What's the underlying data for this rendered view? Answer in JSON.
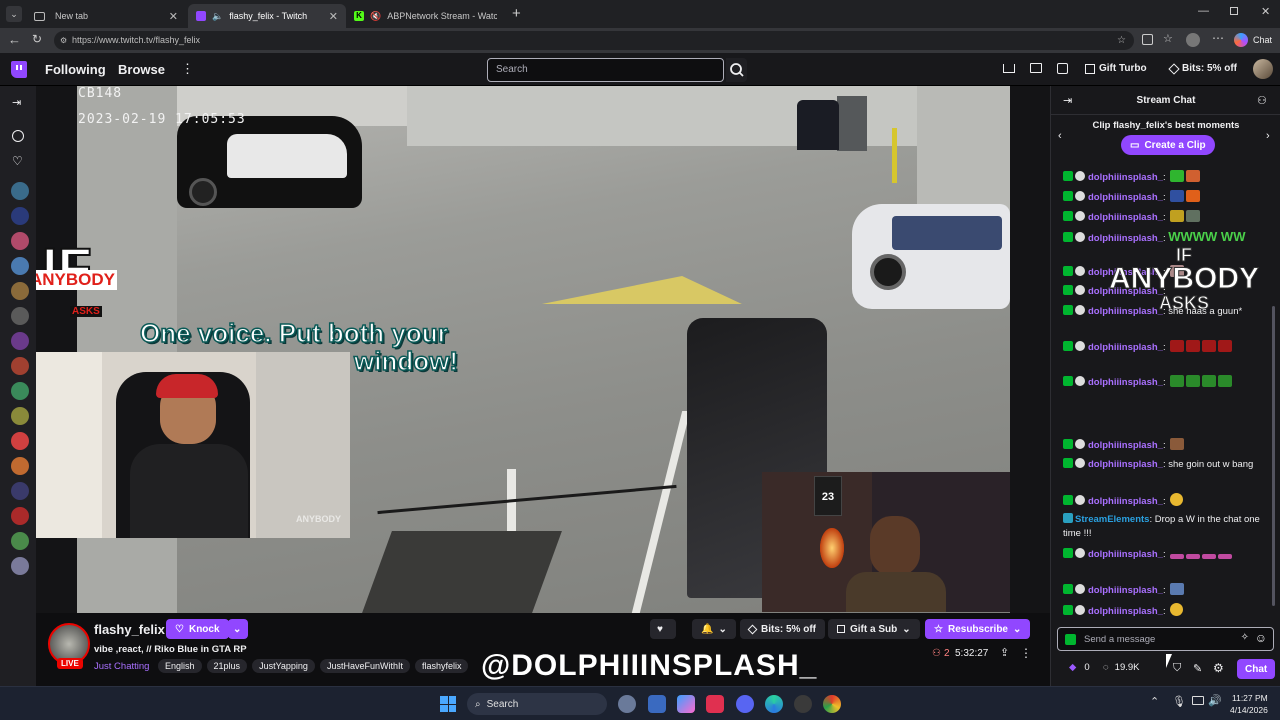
{
  "browser": {
    "tabs": [
      {
        "label": "New tab",
        "active": false
      },
      {
        "label": "flashy_felix - Twitch",
        "active": true
      },
      {
        "label": "ABPNetwork Stream - Watch",
        "active": false
      }
    ],
    "url": "https://www.twitch.tv/flashy_felix",
    "chat_label": "Chat"
  },
  "nav": {
    "following": "Following",
    "browse": "Browse",
    "search_placeholder": "Search",
    "gift_turbo": "Gift Turbo",
    "bits": "Bits: 5% off"
  },
  "video": {
    "cam_id": "CB148",
    "timestamp": "2023-02-19 17:05:53",
    "caption_line1": "One voice. Put both your",
    "caption_line2": "window!",
    "logo_top": "IF",
    "logo_mid": "ANYBODY",
    "logo_bot": "ASKS",
    "jersey": "23"
  },
  "stream": {
    "channel": "flashy_felix",
    "knock": "Knock",
    "title": "vibe ,react, // Riko Blue in GTA RP",
    "live": "LIVE",
    "category": "Just Chatting",
    "tags": [
      "English",
      "21plus",
      "JustYapping",
      "JustHaveFunWithIt",
      "flashyfelix"
    ],
    "bits": "Bits: 5% off",
    "gift_sub": "Gift a Sub",
    "resubscribe": "Resubscribe",
    "viewers": "2",
    "uptime": "5:32:27",
    "watermark": "@DOLPHIIINSPLASH_"
  },
  "chat": {
    "title": "Stream Chat",
    "clip_prompt": "Clip flashy_felix's best moments",
    "create_clip": "Create a Clip",
    "messages": [
      {
        "user": "dolphiiinsplash_",
        "text": ""
      },
      {
        "user": "dolphiiinsplash_",
        "text": ""
      },
      {
        "user": "dolphiiinsplash_",
        "text": ""
      },
      {
        "user": "dolphiiinsplash_",
        "text": "WWWW WW"
      },
      {
        "user": "dolphiiinsplash_",
        "text": ""
      },
      {
        "user": "dolphiiinsplash_",
        "text": ""
      },
      {
        "user": "dolphiiinsplash_",
        "text": "she haas a guun*"
      },
      {
        "user": "dolphiiinsplash_",
        "text": ""
      },
      {
        "user": "dolphiiinsplash_",
        "text": ""
      },
      {
        "user": "dolphiiinsplash_",
        "text": ""
      },
      {
        "user": "dolphiiinsplash_",
        "text": "she goin out w bang"
      },
      {
        "user": "dolphiiinsplash_",
        "text": ""
      },
      {
        "user": "StreamElements",
        "text": "Drop a W in the chat one time !!!"
      },
      {
        "user": "dolphiiinsplash_",
        "text": ""
      },
      {
        "user": "dolphiiinsplash_",
        "text": ""
      },
      {
        "user": "dolphiiinsplash_",
        "text": ""
      }
    ],
    "chat_overlay_if": "IF",
    "chat_overlay_anybody": "ANYBODY",
    "chat_overlay_asks": "ASKS",
    "input_placeholder": "Send a message",
    "points": "0",
    "channel_points": "19.9K",
    "chat_button": "Chat"
  },
  "taskbar": {
    "search": "Search",
    "time": "11:27 PM",
    "date": "4/14/2026"
  },
  "colors": {
    "twitch_purple": "#9147ff",
    "username": "#a970ff",
    "live_red": "#eb0400",
    "mod_green": "#00b62f"
  }
}
